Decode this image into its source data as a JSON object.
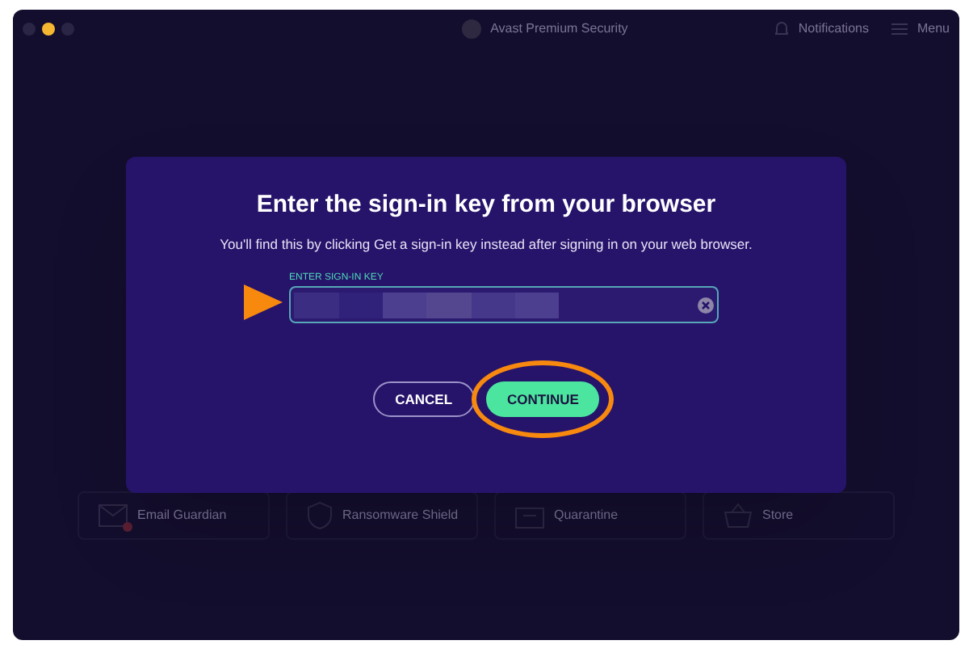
{
  "window": {
    "title": "Avast Premium Security",
    "notifications": "Notifications",
    "menu": "Menu"
  },
  "tiles": [
    {
      "label": "Email Guardian",
      "kind": "mail",
      "alert": true
    },
    {
      "label": "Ransomware Shield",
      "kind": "shield",
      "alert": false
    },
    {
      "label": "Quarantine",
      "kind": "box",
      "alert": false
    },
    {
      "label": "Store",
      "kind": "cart",
      "alert": false
    }
  ],
  "dialog": {
    "title": "Enter the sign-in key from your browser",
    "subtitle": "You'll find this by clicking Get a sign-in key instead after signing in on your web browser.",
    "field_label": "ENTER SIGN-IN KEY",
    "buttons": [
      {
        "label": "CANCEL",
        "kind": "secondary",
        "highlighted": false
      },
      {
        "label": "CONTINUE",
        "kind": "primary",
        "highlighted": true
      }
    ]
  }
}
